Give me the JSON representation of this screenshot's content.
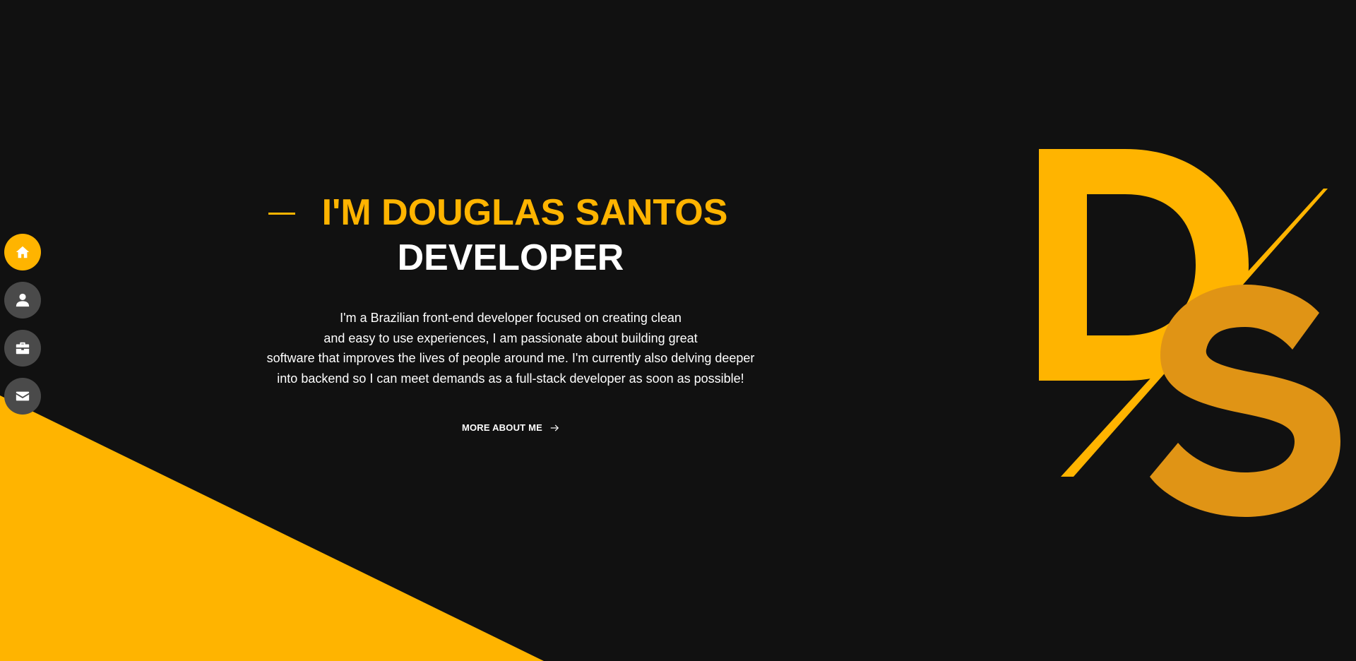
{
  "nav": {
    "items": [
      {
        "name": "home",
        "icon": "home-icon",
        "active": true
      },
      {
        "name": "about",
        "icon": "user-icon",
        "active": false
      },
      {
        "name": "portfolio",
        "icon": "briefcase-icon",
        "active": false
      },
      {
        "name": "contact",
        "icon": "mail-icon",
        "active": false
      }
    ]
  },
  "hero": {
    "title": "I'M DOUGLAS SANTOS",
    "subtitle": "DEVELOPER",
    "description_lines": [
      "I'm a Brazilian front-end developer focused on creating clean",
      "and easy to use experiences, I am passionate about building great",
      "software that improves the lives of people around me. I'm currently also delving deeper",
      "into backend so I can meet demands as a full-stack developer as soon as possible!"
    ],
    "cta_label": "MORE ABOUT ME",
    "cta_icon": "arrow-right-icon"
  },
  "logo": {
    "icon": "ds-monogram-logo",
    "letters": "DS"
  },
  "colors": {
    "background": "#111111",
    "accent": "#ffb400",
    "accent_dark": "#e09415",
    "nav_inactive": "#4a4a4a",
    "text": "#ffffff"
  }
}
